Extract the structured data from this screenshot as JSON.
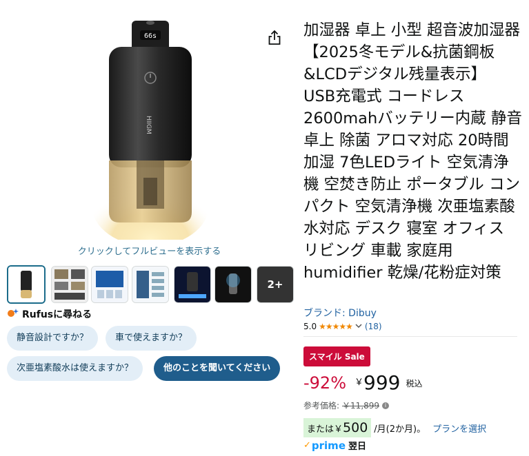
{
  "product": {
    "title": "加湿器 卓上 小型 超音波加湿器 【2025冬モデル&抗菌鋼板&LCDデジタル残量表示】 USB充電式 コードレス 2600mahバッテリー内蔵 静音 卓上 除菌 アロマ対応 20時間加湿 7色LEDライト 空気清浄機 空焚き防止 ポータブル コンパクト 空気清浄機 次亜塩素酸水対応 デスク 寝室 オフィス リビング 車載 家庭用 humidifier 乾燥/花粉症対策",
    "brand": "ブランド: Dibuy",
    "rating_value": "5.0",
    "rating_count": "(18)",
    "device_display": "66s",
    "device_label": "HIIGM"
  },
  "gallery": {
    "fullview_link": "クリックしてフルビューを表示する",
    "more_label": "2+"
  },
  "rufus": {
    "title": "Rufusに尋ねる",
    "chips": [
      "静音設計ですか？",
      "車で使えますか？",
      "次亜塩素酸水は使えますか？",
      "他のことを聞いてください"
    ]
  },
  "pricing": {
    "sale_badge": "スマイル Sale",
    "discount": "-92%",
    "currency": "￥",
    "price": "999",
    "tax_label": "税込",
    "ref_label": "参考価格:",
    "ref_price": "￥11,899",
    "install_prefix": "または",
    "install_yen": "￥",
    "install_amount": "500",
    "install_suffix": "/月(2か月)。",
    "plan_link": "プランを選択",
    "prime_label": "prime",
    "delivery": "翌日"
  },
  "colors": {
    "link": "#2162a1",
    "sale_red": "#cc0c39",
    "chip_bg": "#e3eef7",
    "chip_dark": "#1f5d8c",
    "install_bg": "#d9f4d8",
    "star": "#f08804"
  },
  "icons": {
    "share": "share-icon",
    "rufus": "rufus-sparkle-icon",
    "info": "info-icon",
    "chevron": "chevron-down-icon",
    "prime_check": "prime-check-icon"
  }
}
